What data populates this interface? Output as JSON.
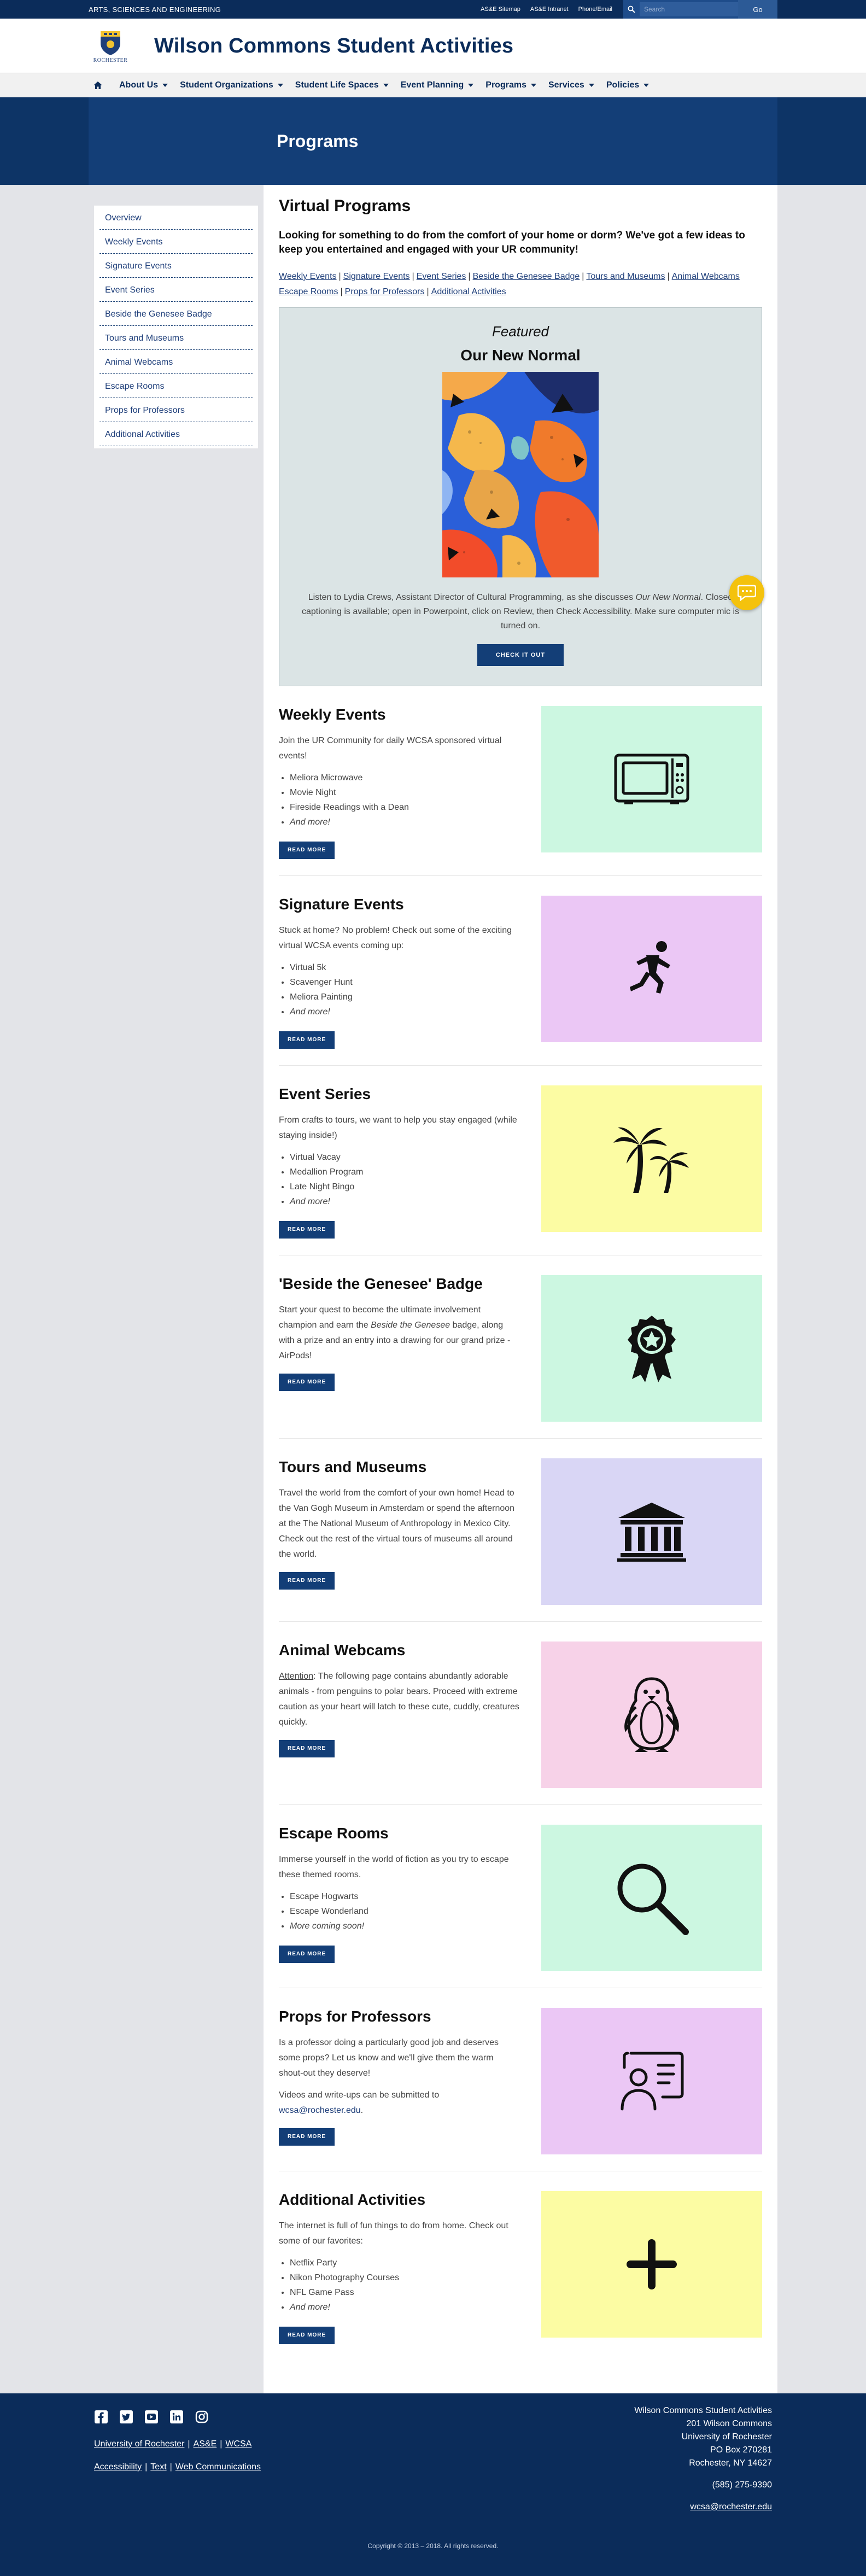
{
  "utility": {
    "brand": "ARTS, SCIENCES AND ENGINEERING",
    "links": [
      "AS&E Sitemap",
      "AS&E Intranet",
      "Phone/Email"
    ],
    "search_placeholder": "Search",
    "search_button": "Go"
  },
  "header": {
    "logo_text": "ROCHESTER",
    "title": "Wilson Commons Student Activities"
  },
  "nav": {
    "items": [
      "About Us",
      "Student Organizations",
      "Student Life Spaces",
      "Event Planning",
      "Programs",
      "Services",
      "Policies"
    ]
  },
  "hero": {
    "title": "Programs"
  },
  "sidebar": {
    "items": [
      "Overview",
      "Weekly Events",
      "Signature Events",
      "Event Series",
      "Beside the Genesee Badge",
      "Tours and Museums",
      "Animal Webcams",
      "Escape Rooms",
      "Props for Professors",
      "Additional Activities"
    ]
  },
  "main": {
    "title": "Virtual Programs",
    "intro": "Looking for something to do from the comfort of your home or dorm? We've got a few ideas to keep you entertained and engaged with your UR community!",
    "toc": [
      "Weekly Events",
      "Signature Events",
      "Event Series",
      "Beside the Genesee Badge",
      "Tours and Museums",
      "Animal Webcams",
      "Escape Rooms",
      "Props for Professors",
      "Additional Activities"
    ],
    "featured": {
      "kicker": "Featured",
      "title": "Our New Normal",
      "text_before": "Listen to Lydia Crews, Assistant Director of Cultural Programming, as she discusses ",
      "text_italic": "Our New Normal",
      "text_after": ". Closed captioning is available; open in Powerpoint, click on Review, then Check Accessibility. Make sure computer mic is turned on.",
      "button": "CHECK IT OUT"
    },
    "sections": [
      {
        "title": "Weekly Events",
        "body": "Join the UR Community for daily WCSA sponsored virtual events!",
        "items": [
          "Meliora Microwave",
          "Movie Night",
          "Fireside Readings with a Dean"
        ],
        "more": "And more!",
        "button": "READ MORE",
        "bg": "#ccf7e1",
        "icon": "microwave-icon"
      },
      {
        "title": "Signature Events",
        "body": "Stuck at home? No problem! Check out some of the exciting virtual WCSA events coming up:",
        "items": [
          "Virtual 5k",
          "Scavenger Hunt",
          "Meliora Painting"
        ],
        "more": "And more!",
        "button": "READ MORE",
        "bg": "#ebc7f5",
        "icon": "runner-icon"
      },
      {
        "title": "Event Series",
        "body": "From crafts to tours, we want to help you stay engaged (while staying inside!)",
        "items": [
          "Virtual Vacay",
          "Medallion Program",
          "Late Night Bingo"
        ],
        "more": "And more!",
        "button": "READ MORE",
        "bg": "#fcfca3",
        "icon": "palm-tree-icon"
      },
      {
        "title": "'Beside the Genesee' Badge",
        "body_before": "Start your quest to become the ultimate involvement champion and earn the ",
        "body_italic": "Beside the Genesee",
        "body_after": " badge, along with a prize and an entry into a drawing for our grand prize - AirPods!",
        "button": "READ MORE",
        "bg": "#ccf7e1",
        "icon": "badge-icon"
      },
      {
        "title": "Tours and Museums",
        "body": "Travel the world from the comfort of your own home! Head to the Van Gogh Museum in Amsterdam or spend the afternoon at the The National Museum of Anthropology in Mexico City. Check out the rest of the virtual tours of museums all around the world.",
        "button": "READ MORE",
        "bg": "#d9d6f5",
        "icon": "museum-icon"
      },
      {
        "title": "Animal Webcams",
        "body_label": "Attention",
        "body": ": The following page contains abundantly adorable animals - from penguins to polar bears. Proceed with extreme caution as your heart will latch to these cute, cuddly, creatures quickly.",
        "button": "READ MORE",
        "bg": "#f7d2e8",
        "icon": "penguin-icon"
      },
      {
        "title": "Escape Rooms",
        "body": "Immerse yourself in the world of fiction as you try to escape these themed rooms.",
        "items": [
          "Escape Hogwarts",
          "Escape Wonderland"
        ],
        "more": "More coming soon!",
        "button": "READ MORE",
        "bg": "#ccf7e1",
        "icon": "magnifier-icon"
      },
      {
        "title": "Props for Professors",
        "body": "Is a professor doing a particularly good job and deserves some props? Let us know and we'll give them the warm shout-out they deserve!",
        "body2": "Videos and write-ups can be submitted to",
        "email": "wcsa@rochester.edu",
        "email_suffix": ".",
        "button": "READ MORE",
        "bg": "#ebc7f5",
        "icon": "professor-icon"
      },
      {
        "title": "Additional Activities",
        "body": "The internet is full of fun things to do from home. Check out some of our favorites:",
        "items": [
          "Netflix Party",
          "Nikon Photography Courses",
          "NFL Game Pass"
        ],
        "more": "And more!",
        "button": "READ MORE",
        "bg": "#fcfca3",
        "icon": "plus-icon"
      }
    ]
  },
  "footer": {
    "links_row1": [
      "University of Rochester",
      "AS&E",
      "WCSA"
    ],
    "links_row2": [
      "Accessibility",
      "Text",
      "Web Communications"
    ],
    "address": [
      "Wilson Commons Student Activities",
      "201 Wilson Commons",
      "University of Rochester",
      "PO Box 270281",
      "Rochester, NY 14627"
    ],
    "phone": "(585) 275-9390",
    "email": "wcsa@rochester.edu",
    "copyright": "Copyright © 2013 – 2018. All rights reserved."
  },
  "colors": {
    "navy": "#0b2c5a",
    "hero": "#133e77",
    "chat": "#f4c20d"
  }
}
